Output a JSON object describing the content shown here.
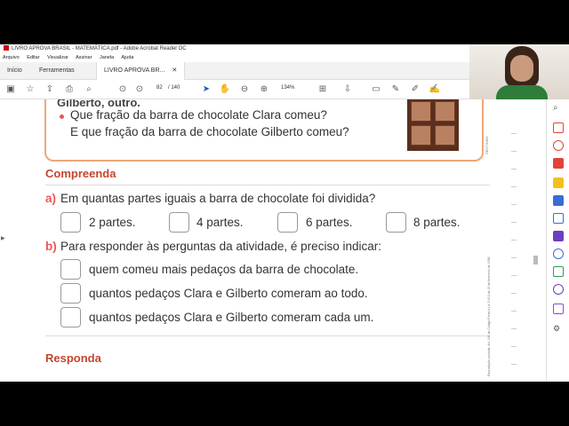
{
  "window": {
    "title": "LIVRO APROVA BRASIL - MATEMÁTICA.pdf - Adobe Acrobat Reader DC",
    "menu": [
      "Arquivo",
      "Editar",
      "Visualizar",
      "Assinar",
      "Janela",
      "Ajuda"
    ]
  },
  "tabs": {
    "home": "Início",
    "tools": "Ferramentas",
    "document": "LIVRO APROVA BR..."
  },
  "toolbar": {
    "page_current": "82",
    "page_total": "/ 140",
    "zoom": "134%"
  },
  "content": {
    "top_partial": "Gilberto, outro.",
    "question_line1": "Que fração da barra de chocolate Clara comeu?",
    "question_line2": "E que fração da barra de chocolate Gilberto comeu?",
    "side_label": "SENTINHO",
    "compreenda": {
      "heading": "Compreenda",
      "a_label": "a)",
      "a_text": "Em quantas partes iguais a barra de chocolate foi dividida?",
      "a_options": [
        "2 partes.",
        "4 partes.",
        "6 partes.",
        "8 partes."
      ],
      "b_label": "b)",
      "b_text": "Para responder às perguntas da atividade, é preciso indicar:",
      "b_options": [
        "quem comeu mais pedaços da barra de chocolate.",
        "quantos pedaços Clara e Gilberto comeram ao todo.",
        "quantos pedaços Clara e Gilberto comeram cada um."
      ]
    },
    "responda": {
      "heading": "Responda"
    },
    "copyright_side": "Reprodução proibida. Art. 184 do Código Penal e Lei 9.610 de 19 de fevereiro de 1998."
  },
  "colors": {
    "accent_label": "#e55555",
    "section_heading": "#c4452e",
    "box_border": "#f0a77a"
  }
}
